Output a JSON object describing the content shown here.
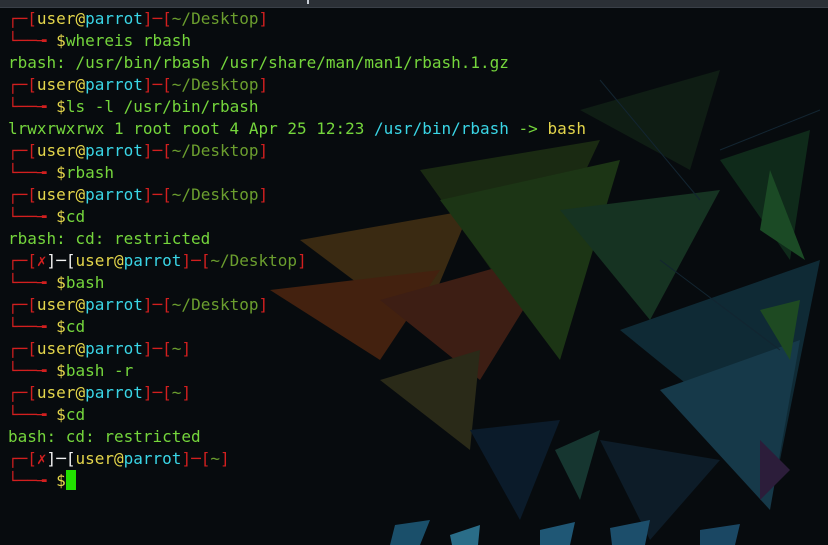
{
  "prompt": {
    "user": "user",
    "at": "@",
    "host": "parrot",
    "dash": "─",
    "corner_top": "┌─",
    "corner_bottom": "└──╼ ",
    "dollar": "$",
    "x_mark": "✗"
  },
  "blocks": [
    {
      "path": "~/Desktop",
      "failed": false,
      "cmd": "whereis rbash",
      "output": "rbash: /usr/bin/rbash /usr/share/man/man1/rbash.1.gz"
    },
    {
      "path": "~/Desktop",
      "failed": false,
      "cmd": "ls -l /usr/bin/rbash",
      "output_parts": [
        "lrwxrwxrwx 1 root root 4 Apr 25 12:23 ",
        "/usr/bin/rbash",
        " -> ",
        "bash"
      ]
    },
    {
      "path": "~/Desktop",
      "failed": false,
      "cmd": "rbash"
    },
    {
      "path": "~/Desktop",
      "failed": false,
      "cmd": "cd",
      "output": "rbash: cd: restricted"
    },
    {
      "path": "~/Desktop",
      "failed": true,
      "cmd": "bash"
    },
    {
      "path": "~/Desktop",
      "failed": false,
      "cmd": "cd"
    },
    {
      "path": "~",
      "failed": false,
      "cmd": "bash -r"
    },
    {
      "path": "~",
      "failed": false,
      "cmd": "cd",
      "output": "bash: cd: restricted"
    },
    {
      "path": "~",
      "failed": true,
      "cmd": ""
    }
  ],
  "colors": {
    "bracket": "#d21f1f",
    "user": "#e4d64b",
    "host": "#3ad6e6",
    "path": "#6b9e2e",
    "output": "#75d63c",
    "cursor": "#22e000"
  }
}
